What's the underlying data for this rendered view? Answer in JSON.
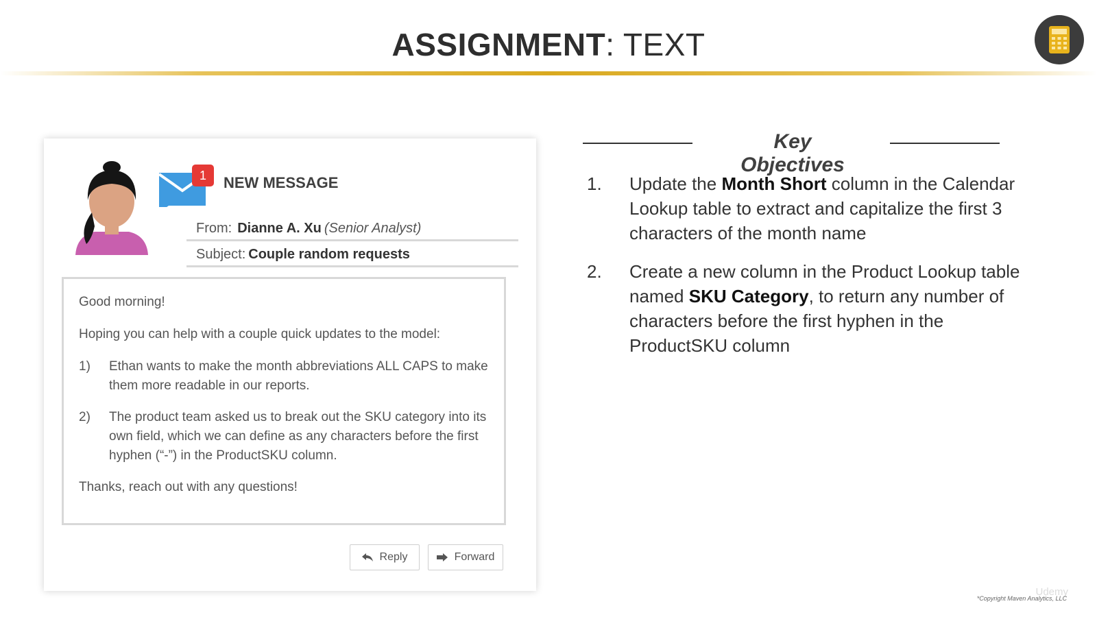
{
  "header": {
    "title_bold": "ASSIGNMENT",
    "title_rest": ": TEXT",
    "icon": "calculator-icon",
    "accent_color": "#d9a91f"
  },
  "email": {
    "badge_count": "1",
    "header_label": "NEW MESSAGE",
    "from_label": "From:",
    "from_name": "Dianne A. Xu",
    "from_role": "(Senior Analyst)",
    "subject_label": "Subject:",
    "subject_value": "Couple random requests",
    "greeting": "Good morning!",
    "intro": "Hoping you can help with a couple quick updates to the model:",
    "items": [
      {
        "num": "1)",
        "text": "Ethan wants to make the month abbreviations ALL CAPS to make them more readable in our reports."
      },
      {
        "num": "2)",
        "text": "The product team asked us to break out the SKU category into its own field, which we can define as any characters before the first hyphen (“-”) in the ProductSKU column."
      }
    ],
    "closing": "Thanks, reach out with any questions!",
    "reply_label": "Reply",
    "forward_label": "Forward"
  },
  "objectives": {
    "heading": "Key Objectives",
    "items": [
      {
        "num": "1.",
        "pre": "Update the ",
        "bold": "Month Short",
        "post": " column in the Calendar Lookup table to extract and capitalize the first 3 characters of the month name"
      },
      {
        "num": "2.",
        "pre": "Create a new column in the Product Lookup table named ",
        "bold": "SKU Category",
        "post": ", to return any number of characters before the first hyphen in the ProductSKU column"
      }
    ]
  },
  "footer": {
    "copyright": "*Copyright Maven Analytics, LLC",
    "watermark": "Udemy"
  }
}
